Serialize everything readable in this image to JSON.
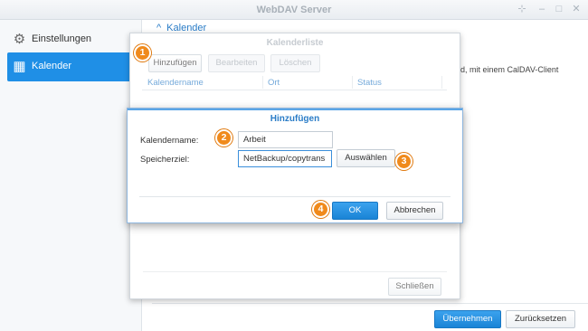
{
  "window": {
    "title": "WebDAV Server"
  },
  "sidebar": {
    "items": [
      {
        "label": "Einstellungen",
        "icon": "gear-icon",
        "selected": false
      },
      {
        "label": "Kalender",
        "icon": "calendar-icon",
        "selected": true
      }
    ]
  },
  "content": {
    "section_title": "Kalender",
    "description_fragment": "d, mit einem CalDAV-Client",
    "apply_label": "Übernehmen",
    "reset_label": "Zurücksetzen"
  },
  "calendar_list_dialog": {
    "title": "Kalenderliste",
    "toolbar": {
      "add": "Hinzufügen",
      "edit": "Bearbeiten",
      "delete": "Löschen"
    },
    "columns": [
      "Kalendername",
      "Ort",
      "Status"
    ],
    "close_label": "Schließen"
  },
  "add_dialog": {
    "title": "Hinzufügen",
    "name_label": "Kalendername:",
    "name_value": "Arbeit",
    "target_label": "Speicherziel:",
    "target_value": "NetBackup/copytrans",
    "browse_label": "Auswählen",
    "ok_label": "OK",
    "cancel_label": "Abbrechen"
  },
  "callouts": [
    "1",
    "2",
    "3",
    "4"
  ],
  "colors": {
    "accent": "#1f8fe6",
    "callout": "#f08a1c",
    "title_blue": "#2a7cc7"
  }
}
